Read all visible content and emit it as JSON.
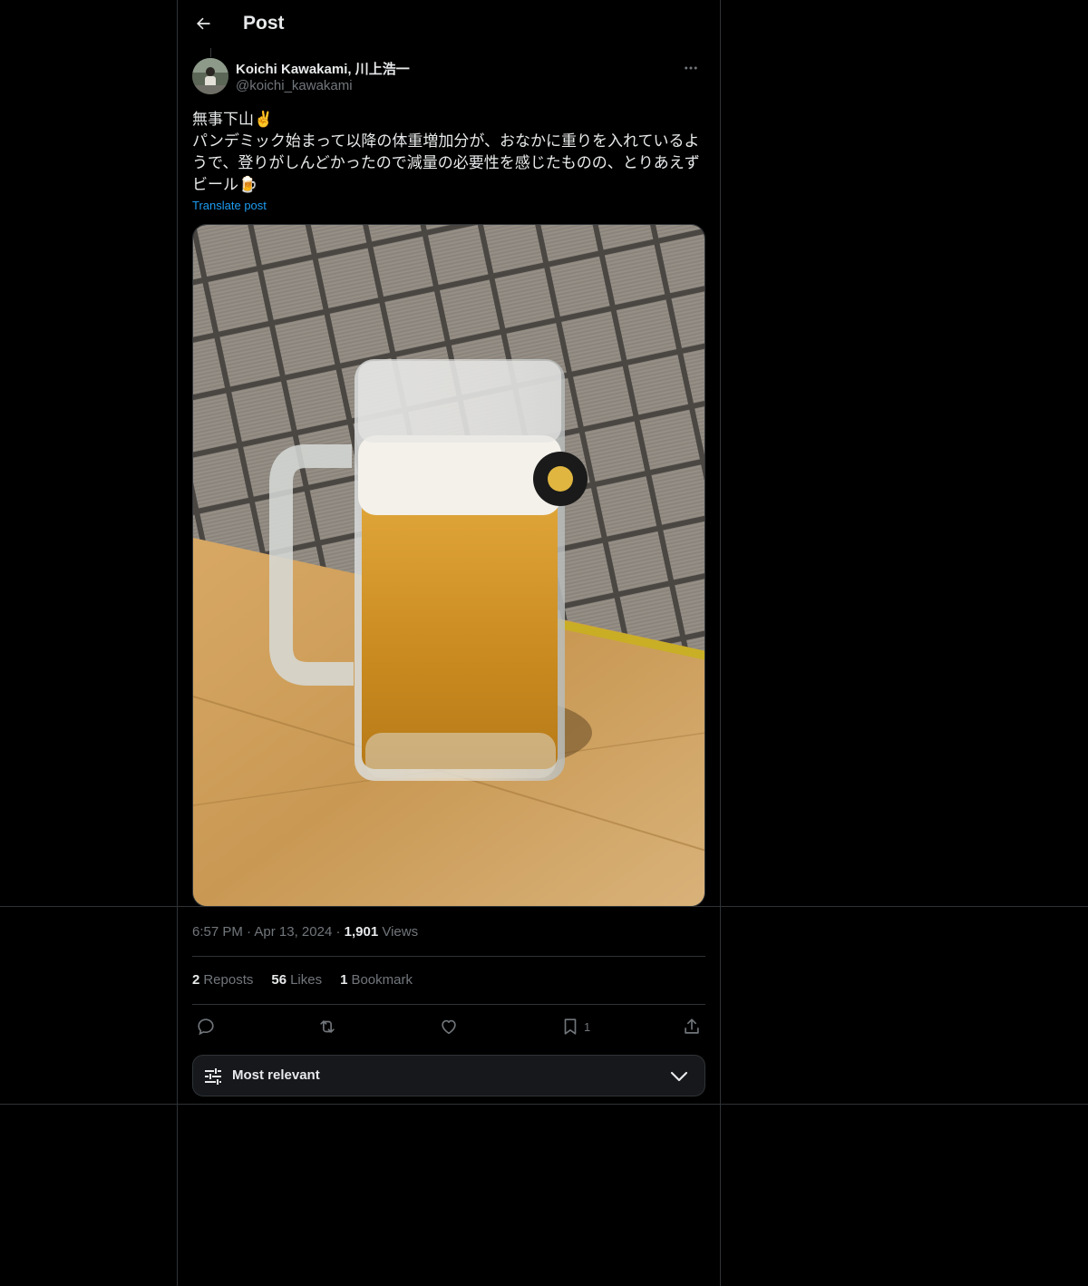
{
  "header": {
    "title": "Post",
    "back_icon": "arrow-left-icon"
  },
  "author": {
    "display_name": "Koichi Kawakami, 川上浩一",
    "handle": "@koichi_kawakami"
  },
  "post": {
    "lines": [
      "無事下山✌️",
      "パンデミック始まって以降の体重増加分が、おなかに重りを入れているよ",
      "うで、登りがしんどかったので減量の必要性を感じたものの、とりあえず",
      "ビール🍺"
    ],
    "translate_label": "Translate post"
  },
  "meta": {
    "time": "6:57 PM",
    "date": "Apr 13, 2024",
    "views_count": "1,901",
    "views_label": "Views"
  },
  "stats": {
    "reposts_count": "2",
    "reposts_label": "Reposts",
    "likes_count": "56",
    "likes_label": "Likes",
    "bookmarks_count": "1",
    "bookmarks_label": "Bookmark"
  },
  "actions": {
    "bookmark_count": "1"
  },
  "sort": {
    "label": "Most relevant"
  },
  "colors": {
    "background": "#000000",
    "border": "#2f3336",
    "link": "#1d9bf0",
    "secondary_text": "#71767b"
  }
}
